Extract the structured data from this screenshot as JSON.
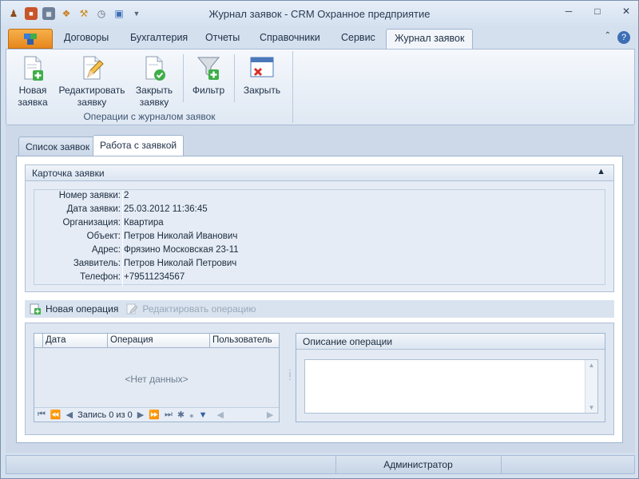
{
  "window": {
    "title": "Журнал заявок - CRM Охранное предприятие",
    "qat_icons": [
      "guard-icon",
      "briefcase-icon",
      "calculator-icon",
      "handshake-icon",
      "tools-icon",
      "stopwatch-icon",
      "window-icon",
      "customize-icon"
    ],
    "controls": [
      "minimize",
      "restore",
      "close"
    ]
  },
  "ribbon": {
    "tabs": [
      "Договоры",
      "Бухгалтерия",
      "Отчеты",
      "Справочники",
      "Сервис",
      "Журнал заявок"
    ],
    "active_tab": "Журнал заявок",
    "buttons": {
      "new_request": "Новая\nзаявка",
      "edit_request": "Редактировать\nзаявку",
      "close_request": "Закрыть\nзаявку",
      "filter": "Фильтр",
      "close": "Закрыть"
    },
    "group_label": "Операции с журналом заявок"
  },
  "content": {
    "tabs": [
      "Список заявок",
      "Работа с заявкой"
    ],
    "active_tab": "Работа с заявкой",
    "card": {
      "title": "Карточка заявки",
      "fields": [
        {
          "label": "Номер заявки:",
          "value": "2"
        },
        {
          "label": "Дата заявки:",
          "value": "25.03.2012 11:36:45"
        },
        {
          "label": "Организация:",
          "value": "Квартира"
        },
        {
          "label": "Объект:",
          "value": "Петров Николай Иванович"
        },
        {
          "label": "Адрес:",
          "value": "Фрязино Московская 23-11"
        },
        {
          "label": "Заявитель:",
          "value": "Петров Николай Петрович"
        },
        {
          "label": "Телефон:",
          "value": "+79511234567"
        }
      ]
    },
    "operations_toolbar": {
      "new_operation": "Новая операция",
      "edit_operation": "Редактировать операцию"
    },
    "grid": {
      "columns": [
        "Дата",
        "Операция",
        "Пользователь"
      ],
      "empty_text": "<Нет данных>",
      "record_text": "Запись 0 из 0"
    },
    "description": {
      "title": "Описание операции",
      "value": ""
    }
  },
  "status": {
    "user": "Администратор"
  },
  "colors": {
    "accent_orange": "#e6871c",
    "ribbon_bg": "#dfe8f3",
    "border": "#9fb4cf"
  }
}
